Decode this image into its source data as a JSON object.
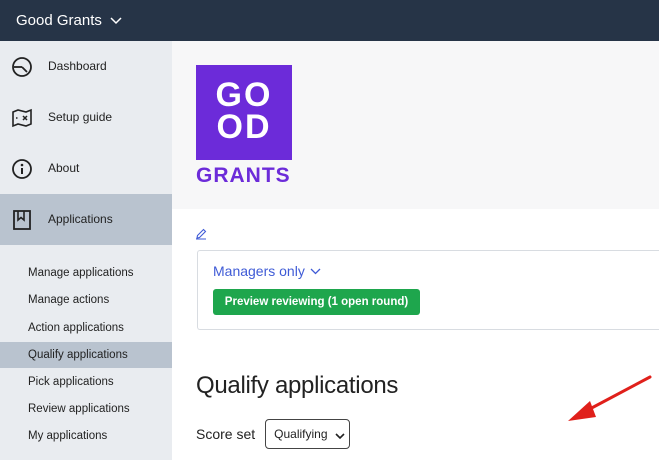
{
  "topbar": {
    "title": "Good Grants"
  },
  "sidebar": {
    "items": [
      {
        "label": "Dashboard",
        "icon": "dashboard-gauge-icon"
      },
      {
        "label": "Setup guide",
        "icon": "setup-guide-map-icon"
      },
      {
        "label": "About",
        "icon": "info-icon"
      },
      {
        "label": "Applications",
        "icon": "bookmark-icon",
        "active": true
      }
    ],
    "subitems": [
      {
        "label": "Manage applications"
      },
      {
        "label": "Manage actions"
      },
      {
        "label": "Action applications"
      },
      {
        "label": "Qualify applications",
        "active": true
      },
      {
        "label": "Pick applications"
      },
      {
        "label": "Review applications"
      },
      {
        "label": "My applications"
      }
    ]
  },
  "logo": {
    "line1": "GO",
    "line2": "OD",
    "word": "GRANTS"
  },
  "card": {
    "managers_label": "Managers only",
    "preview_button": "Preview reviewing (1 open round)"
  },
  "main": {
    "title": "Qualify applications",
    "score_set_label": "Score set",
    "score_set_value": "Qualifying"
  },
  "colors": {
    "topbar": "#263447",
    "sidebar": "#e9ecf0",
    "sidebar_active": "#b9c3cf",
    "brand_purple": "#6c2bd9",
    "link_blue": "#3f5bd6",
    "button_green": "#1ea64d",
    "annotation_arrow": "#e0201b"
  }
}
